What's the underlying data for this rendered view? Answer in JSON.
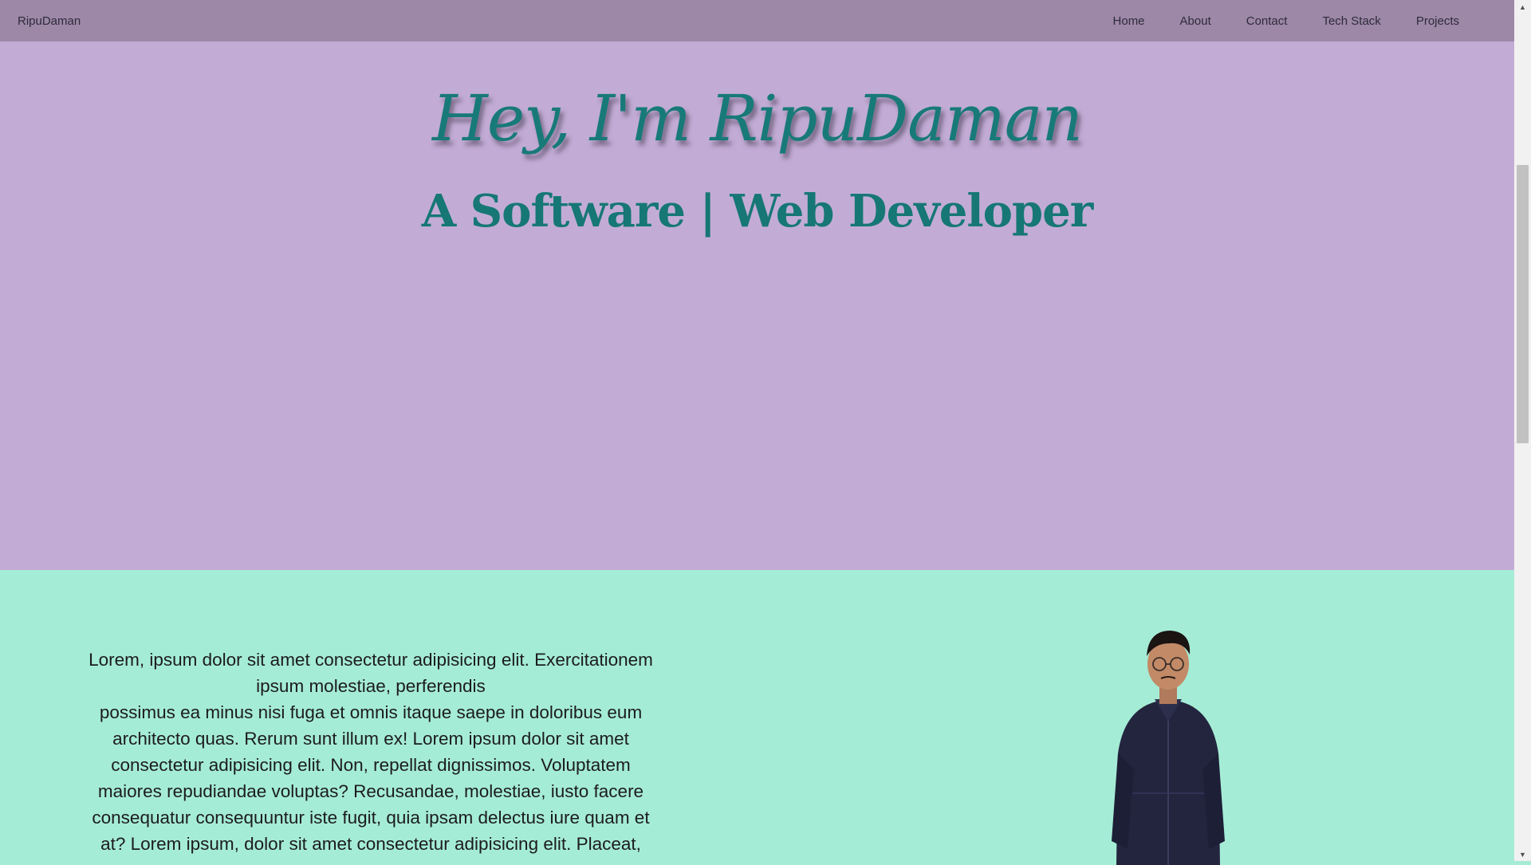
{
  "nav": {
    "brand": "RipuDaman",
    "links": [
      "Home",
      "About",
      "Contact",
      "Tech Stack",
      "Projects"
    ]
  },
  "hero": {
    "title": "Hey, I'm RipuDaman",
    "subtitle": "A Software | Web Developer"
  },
  "about": {
    "lines": [
      "Lorem, ipsum dolor sit amet consectetur adipisicing elit. Exercitationem ipsum molestiae, perferendis",
      "possimus ea minus nisi fuga et omnis itaque saepe in doloribus eum architecto quas. Rerum sunt illum ex! Lorem ipsum dolor sit amet consectetur adipisicing elit. Non, repellat dignissimos. Voluptatem maiores repudiandae voluptas? Recusandae, molestiae, iusto facere consequatur consequuntur iste fugit, quia ipsam delectus iure quam et at? Lorem ipsum, dolor sit amet consectetur adipisicing elit. Placeat,"
    ]
  },
  "colors": {
    "navbar": "#9d88a8",
    "hero_bg": "#c2acd5",
    "about_bg": "#a5ecd7",
    "accent_teal": "#187a78"
  },
  "icons": {
    "scroll_up": "scroll-up-arrow-icon",
    "scroll_down": "scroll-down-arrow-icon"
  }
}
